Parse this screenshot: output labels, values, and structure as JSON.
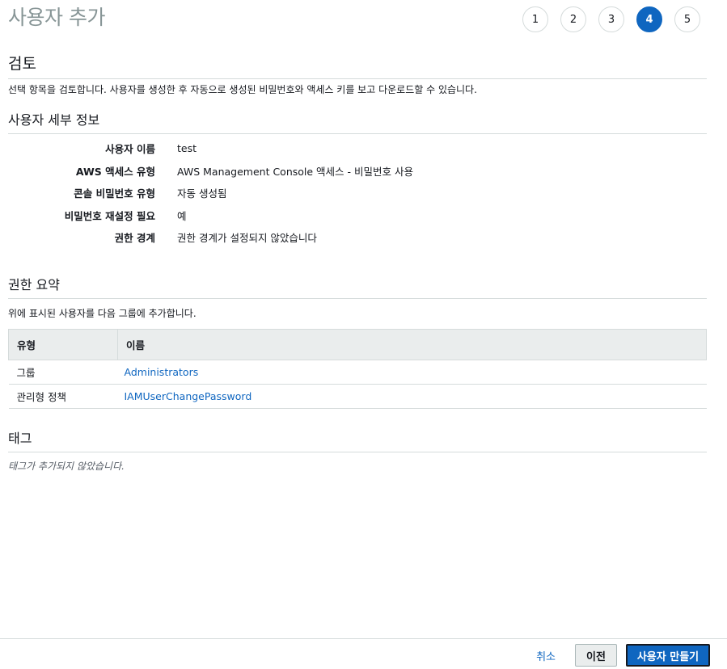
{
  "page": {
    "title": "사용자 추가"
  },
  "steps": [
    "1",
    "2",
    "3",
    "4",
    "5"
  ],
  "active_step": "4",
  "review": {
    "title": "검토",
    "description": "선택 항목을 검토합니다. 사용자를 생성한 후 자동으로 생성된 비밀번호와 액세스 키를 보고 다운로드할 수 있습니다."
  },
  "user_details": {
    "title": "사용자 세부 정보",
    "rows": [
      {
        "label": "사용자 이름",
        "value": "test"
      },
      {
        "label": "AWS 액세스 유형",
        "value": "AWS Management Console 액세스 - 비밀번호 사용"
      },
      {
        "label": "콘솔 비밀번호 유형",
        "value": "자동 생성됨"
      },
      {
        "label": "비밀번호 재설정 필요",
        "value": "예"
      },
      {
        "label": "권한 경계",
        "value": "권한 경계가 설정되지 않았습니다"
      }
    ]
  },
  "permissions": {
    "title": "권한 요약",
    "description": "위에 표시된 사용자를 다음 그룹에 추가합니다.",
    "columns": [
      "유형",
      "이름"
    ],
    "rows": [
      {
        "type": "그룹",
        "name": "Administrators"
      },
      {
        "type": "관리형 정책",
        "name": "IAMUserChangePassword"
      }
    ]
  },
  "tags": {
    "title": "태그",
    "empty_text": "태그가 추가되지 않았습니다."
  },
  "footer": {
    "cancel_label": "취소",
    "previous_label": "이전",
    "create_label": "사용자 만들기"
  },
  "colors": {
    "accent": "#0f66c0",
    "muted_title": "#879596",
    "border": "#d5dbdb",
    "header_bg": "#eaeded"
  }
}
